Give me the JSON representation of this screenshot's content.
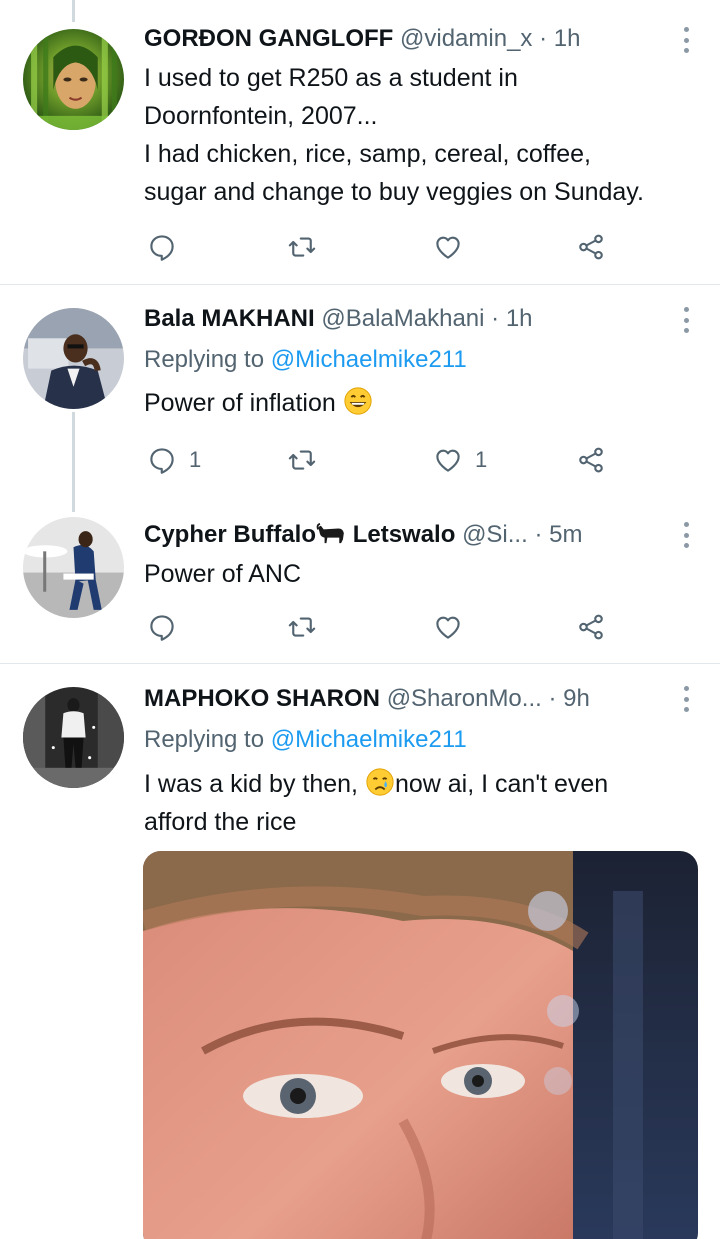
{
  "tweets": [
    {
      "name": "GORÐON GANGLOFF",
      "handle": "@vidamin_x",
      "dot": "·",
      "time": "1h",
      "lines": [
        "I used to get R250 as a student in",
        "Doornfontein, 2007...",
        "I had chicken, rice, samp, cereal, coffee,",
        "sugar and change to buy veggies on Sunday."
      ],
      "reply_count": "",
      "like_count": ""
    },
    {
      "name": "Bala MAKHANI",
      "handle": "@BalaMakhani",
      "dot": "·",
      "time": "1h",
      "replying_prefix": "Replying to",
      "replying_mention": "@Michaelmike211",
      "text": "Power of inflation",
      "reply_count": "1",
      "like_count": "1"
    },
    {
      "name_part1": "Cypher Buffalo",
      "name_part2": "Letswalo",
      "handle": "@Si...",
      "dot": "·",
      "time": "5m",
      "text": "Power of ANC",
      "reply_count": "",
      "like_count": ""
    },
    {
      "name": "MAPHOKO SHARON",
      "handle": "@SharonMo...",
      "dot": "·",
      "time": "9h",
      "replying_prefix": "Replying to",
      "replying_mention": "@Michaelmike211",
      "text_before_emoji": "I was a kid by then,",
      "text_after_emoji": "now ai, I can't even",
      "text_line2": "afford the rice"
    }
  ],
  "icons": {
    "reply": "reply-icon",
    "retweet": "retweet-icon",
    "like": "heart-icon",
    "share": "share-icon",
    "more": "more-options-icon"
  },
  "colors": {
    "link": "#1d9bf0",
    "secondary": "#536471",
    "text": "#0f1419",
    "divider": "#e1e8ed"
  }
}
